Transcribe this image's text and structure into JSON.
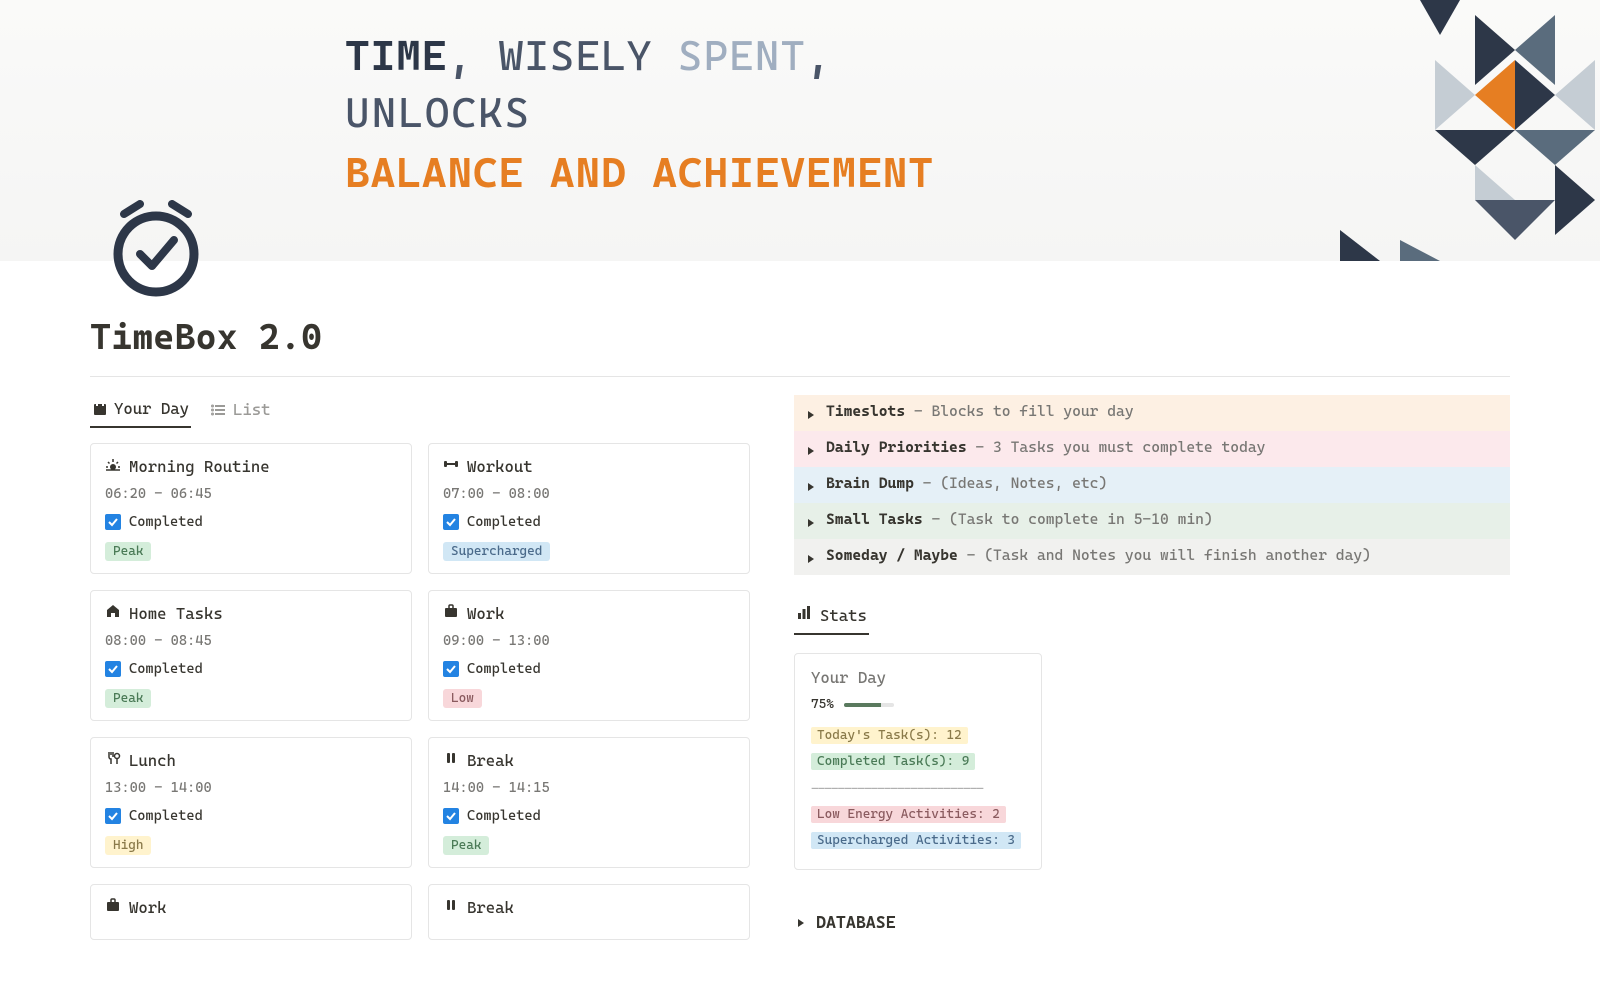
{
  "hero": {
    "line1_time": "TIME",
    "line1_comma1": ", ",
    "line1_wisely": "WISELY ",
    "line1_spent": "SPENT",
    "line1_comma2": ",",
    "line2_unlocks": "UNLOCKS",
    "line3_balance": "BALANCE AND ACHIEVEMENT"
  },
  "page": {
    "title": "TimeBox 2.0"
  },
  "tabs": {
    "yourday": "Your Day",
    "list": "List"
  },
  "cards": [
    {
      "icon": "sunrise",
      "title": "Morning Routine",
      "time": "06:20 - 06:45",
      "completed": "Completed",
      "tag": "Peak",
      "tagClass": "tag-peak"
    },
    {
      "icon": "dumbbell",
      "title": "Workout",
      "time": "07:00 - 08:00",
      "completed": "Completed",
      "tag": "Supercharged",
      "tagClass": "tag-supercharged"
    },
    {
      "icon": "home",
      "title": "Home Tasks",
      "time": "08:00 - 08:45",
      "completed": "Completed",
      "tag": "Peak",
      "tagClass": "tag-peak"
    },
    {
      "icon": "briefcase",
      "title": "Work",
      "time": "09:00 - 13:00",
      "completed": "Completed",
      "tag": "Low",
      "tagClass": "tag-low"
    },
    {
      "icon": "fork",
      "title": "Lunch",
      "time": "13:00 - 14:00",
      "completed": "Completed",
      "tag": "High",
      "tagClass": "tag-high"
    },
    {
      "icon": "pause",
      "title": "Break",
      "time": "14:00 - 14:15",
      "completed": "Completed",
      "tag": "Peak",
      "tagClass": "tag-peak"
    },
    {
      "icon": "briefcase",
      "title": "Work",
      "time": "",
      "completed": "",
      "tag": "",
      "tagClass": ""
    },
    {
      "icon": "pause",
      "title": "Break",
      "time": "",
      "completed": "",
      "tag": "",
      "tagClass": ""
    }
  ],
  "toggles": [
    {
      "label": "Timeslots",
      "desc": " - Blocks to fill your day",
      "bg": "bg-orange"
    },
    {
      "label": "Daily Priorities",
      "desc": " - 3 Tasks you must complete today",
      "bg": "bg-pink"
    },
    {
      "label": "Brain Dump",
      "desc": " - (Ideas, Notes, etc)",
      "bg": "bg-blue"
    },
    {
      "label": "Small Tasks",
      "desc": " - (Task to complete in 5-10 min)",
      "bg": "bg-green"
    },
    {
      "label": "Someday / Maybe",
      "desc": " - (Task and Notes you will finish another day)",
      "bg": "bg-gray"
    }
  ],
  "stats": {
    "tab": "Stats",
    "card_title": "Your Day",
    "pct": "75%",
    "pct_val": 75,
    "today": "Today's Task(s): 12",
    "completed": "Completed Task(s): 9",
    "divider": "--------------------------",
    "low": "Low Energy Activities: 2",
    "super": "Supercharged Activities: 3"
  },
  "database": {
    "label": "DATABASE"
  }
}
